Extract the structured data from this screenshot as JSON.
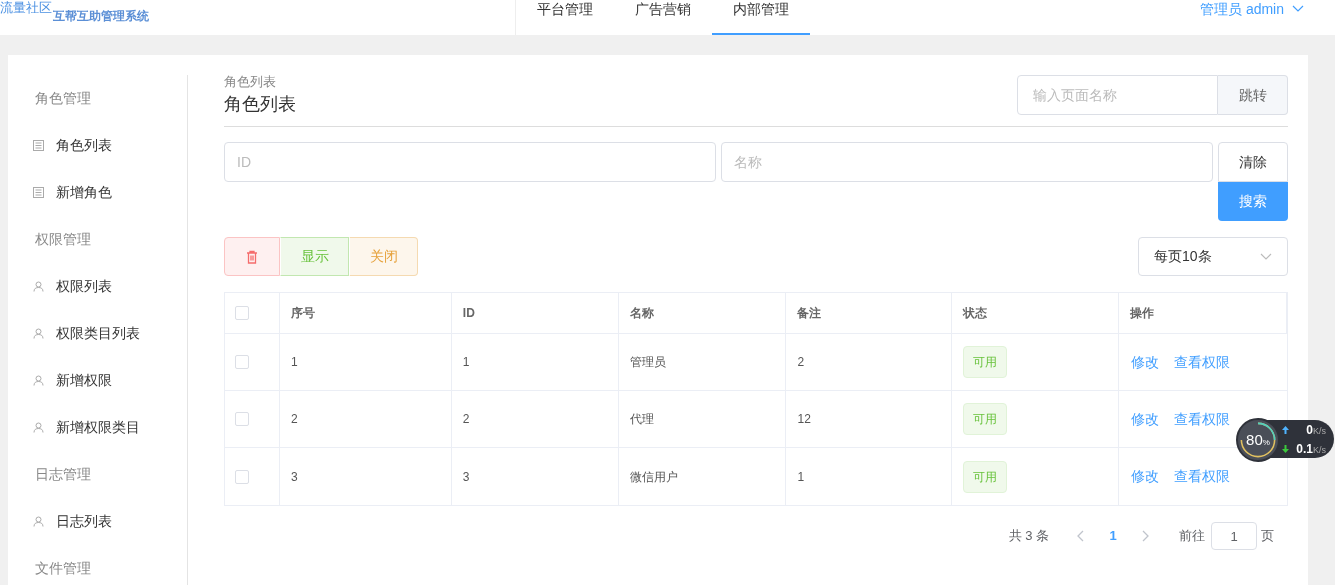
{
  "header": {
    "logo_text": "流量社区",
    "system_name": "互帮互助管理系统",
    "nav": [
      {
        "label": "平台管理",
        "selected": false
      },
      {
        "label": "广告营销",
        "selected": false
      },
      {
        "label": "内部管理",
        "selected": true
      }
    ],
    "user": "管理员 admin"
  },
  "sidebar": {
    "groups": [
      {
        "title": "角色管理",
        "items": [
          {
            "label": "角色列表",
            "kind": "list"
          },
          {
            "label": "新增角色",
            "kind": "list"
          }
        ]
      },
      {
        "title": "权限管理",
        "items": [
          {
            "label": "权限列表",
            "kind": "user"
          },
          {
            "label": "权限类目列表",
            "kind": "user"
          },
          {
            "label": "新增权限",
            "kind": "user"
          },
          {
            "label": "新增权限类目",
            "kind": "user"
          }
        ]
      },
      {
        "title": "日志管理",
        "items": [
          {
            "label": "日志列表",
            "kind": "user"
          }
        ]
      },
      {
        "title": "文件管理"
      }
    ]
  },
  "main": {
    "breadcrumb": "角色列表",
    "title": "角色列表",
    "jump": {
      "placeholder": "输入页面名称",
      "button": "跳转"
    },
    "filters": [
      {
        "placeholder": "ID"
      },
      {
        "placeholder": "名称"
      }
    ],
    "clear_button": "清除",
    "search_button": "搜索",
    "actions": [
      {
        "kind": "delete"
      },
      {
        "kind": "show",
        "label": "显示"
      },
      {
        "kind": "close",
        "label": "关闭"
      }
    ],
    "page_size": "每页10条",
    "table": {
      "all_checked": false,
      "columns": [
        "序号",
        "ID",
        "名称",
        "备注",
        "状态",
        "操作"
      ],
      "rows": [
        {
          "checked": false,
          "cells": [
            "1",
            "1",
            "管理员",
            "2"
          ],
          "status": "可用",
          "actions": [
            "修改",
            "查看权限"
          ]
        },
        {
          "checked": false,
          "cells": [
            "2",
            "2",
            "代理",
            "12"
          ],
          "status": "可用",
          "actions": [
            "修改",
            "查看权限"
          ]
        },
        {
          "checked": false,
          "cells": [
            "3",
            "3",
            "微信用户",
            "1"
          ],
          "status": "可用",
          "actions": [
            "修改",
            "查看权限"
          ]
        }
      ]
    },
    "pagination": {
      "total": "共 3 条",
      "pages": [
        {
          "label": "1",
          "selected": true
        }
      ],
      "goto_label": "前往",
      "goto_value": "1",
      "page_suffix": "页"
    }
  },
  "speed_widget": {
    "percent": "80",
    "percent_sign": "%",
    "up": "0",
    "up_unit": "K/s",
    "down": "0.1",
    "down_unit": "K/s"
  }
}
